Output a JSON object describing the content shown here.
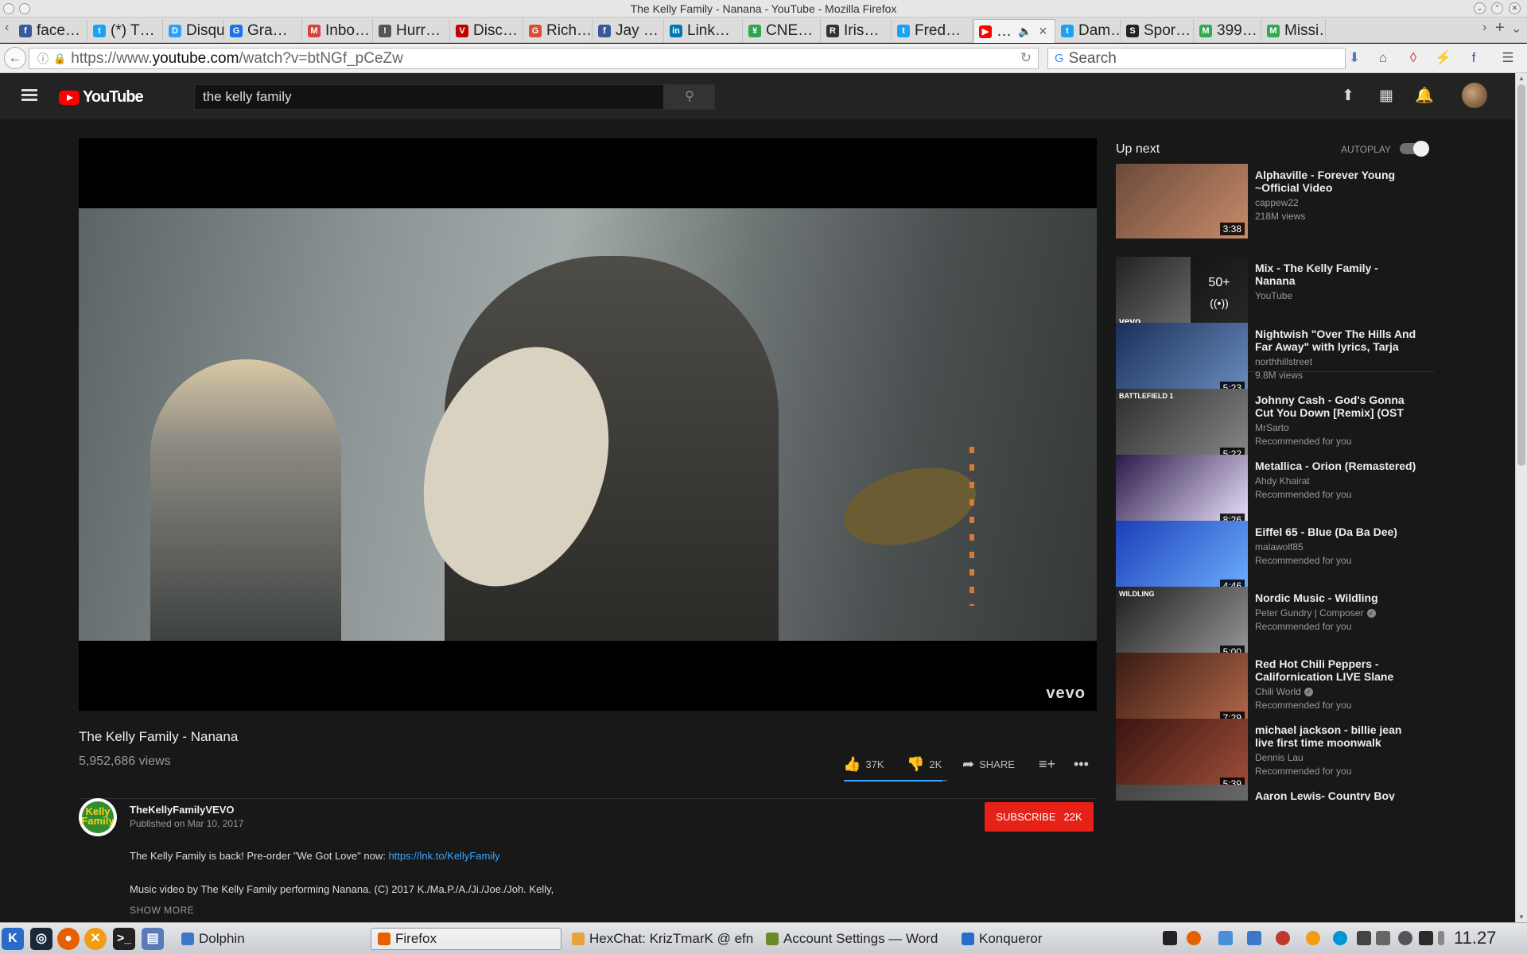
{
  "window": {
    "title": "The Kelly Family - Nanana - YouTube - Mozilla Firefox"
  },
  "tabs": [
    {
      "label": "face…",
      "color": "#3b5998",
      "glyph": "f"
    },
    {
      "label": "(*) T…",
      "color": "#1da1f2",
      "glyph": "t"
    },
    {
      "label": "Disqus",
      "color": "#2e9fff",
      "glyph": "D"
    },
    {
      "label": "Gra…",
      "color": "#1a73e8",
      "glyph": "G"
    },
    {
      "label": "Inbo…",
      "color": "#d44638",
      "glyph": "M"
    },
    {
      "label": "Hurr…",
      "color": "#555555",
      "glyph": "!"
    },
    {
      "label": "Disc…",
      "color": "#c00000",
      "glyph": "V"
    },
    {
      "label": "Rich…",
      "color": "#dd4b39",
      "glyph": "G"
    },
    {
      "label": "Jay …",
      "color": "#3b5998",
      "glyph": "f"
    },
    {
      "label": "Link…",
      "color": "#0077b5",
      "glyph": "in"
    },
    {
      "label": "CNE…",
      "color": "#2aa84a",
      "glyph": "¥"
    },
    {
      "label": "Iris…",
      "color": "#333333",
      "glyph": "R"
    },
    {
      "label": "Fred…",
      "color": "#1da1f2",
      "glyph": "t"
    },
    {
      "label": "…",
      "color": "#ff0000",
      "glyph": "▶",
      "active": true
    },
    {
      "label": "Dam…",
      "color": "#1da1f2",
      "glyph": "t"
    },
    {
      "label": "Spor…",
      "color": "#222222",
      "glyph": "S"
    },
    {
      "label": "399…",
      "color": "#34a853",
      "glyph": "M"
    },
    {
      "label": "Missi…",
      "color": "#34a853",
      "glyph": "M"
    }
  ],
  "nav": {
    "url_prefix": "https://www.",
    "url_domain": "youtube.com",
    "url_path": "/watch?v=btNGf_pCeZw",
    "search_placeholder": "Search"
  },
  "youtube": {
    "logo_text": "YouTube",
    "search_value": "the kelly family",
    "video": {
      "title": "The Kelly Family - Nanana",
      "views": "5,952,686 views",
      "likes": "37K",
      "dislikes": "2K",
      "share_label": "SHARE",
      "like_ratio": 0.95,
      "watermark": "vevo"
    },
    "channel": {
      "name": "TheKellyFamilyVEVO",
      "published": "Published on Mar 10, 2017",
      "avatar_text": "Kelly Family",
      "subscribe_label": "SUBSCRIBE",
      "subscriber_count": "22K"
    },
    "description": {
      "line1": "The Kelly Family is back! Pre-order \"We Got Love\" now: ",
      "link": "https://lnk.to/KellyFamily",
      "line2": "Music video by The Kelly Family performing Nanana. (C) 2017 K./Ma.P./A./Ji./Joe./Joh. Kelly,",
      "show_more": "SHOW MORE"
    },
    "sidebar": {
      "up_next": "Up next",
      "autoplay": "AUTOPLAY",
      "videos": [
        {
          "title": "Alphaville - Forever Young ~Official Video",
          "channel": "cappew22",
          "meta": "218M views",
          "duration": "3:38",
          "thumb": [
            "#6a4a3a",
            "#c88a6a"
          ],
          "progress": 0
        },
        {
          "title": "Mix - The Kelly Family - Nanana",
          "channel": "YouTube",
          "meta": "",
          "duration": "",
          "mix_count": "50+",
          "thumb": [
            "#222222",
            "#888888"
          ],
          "progress": 0,
          "mix": true,
          "thumb_label": "vevo"
        },
        {
          "title": "Nightwish \"Over The Hills And Far Away\" with lyrics, Tarja",
          "channel": "northhillstreet",
          "meta": "9.8M views",
          "duration": "5:23",
          "thumb": [
            "#1b2f5a",
            "#6b8fbf"
          ],
          "progress": 1
        },
        {
          "title": "Johnny Cash - God's Gonna Cut You Down [Remix] (OST",
          "channel": "MrSarto",
          "meta": "Recommended for you",
          "duration": "5:22",
          "thumb": [
            "#2c2c2c",
            "#8a8a8a"
          ],
          "progress": 1,
          "thumb_label": "BATTLEFIELD 1"
        },
        {
          "title": "Metallica - Orion (Remastered)",
          "channel": "Ahdy Khairat",
          "meta": "Recommended for you",
          "duration": "8:26",
          "thumb": [
            "#2a1a4a",
            "#f0e6ff"
          ],
          "progress": 1
        },
        {
          "title": "Eiffel 65 - Blue (Da Ba Dee)",
          "channel": "malawolf85",
          "meta": "Recommended for you",
          "duration": "4:46",
          "thumb": [
            "#1a3fb8",
            "#6fb0ff"
          ],
          "progress": 1
        },
        {
          "title": "Nordic Music - Wildling",
          "channel": "Peter Gundry | Composer",
          "verified": true,
          "meta": "Recommended for you",
          "duration": "5:00",
          "thumb": [
            "#1e1e1e",
            "#9a9a9a"
          ],
          "progress": 0,
          "thumb_label": "WILDLING"
        },
        {
          "title": "Red Hot Chili Peppers - Californication LIVE Slane",
          "channel": "Chili World",
          "verified": true,
          "meta": "Recommended for you",
          "duration": "7:29",
          "thumb": [
            "#3a1a12",
            "#b36a4a"
          ],
          "progress": 0
        },
        {
          "title": "michael jackson - billie jean live first time moonwalk",
          "channel": "Dennis Lau",
          "meta": "Recommended for you",
          "duration": "5:39",
          "thumb": [
            "#3a1410",
            "#a0503a"
          ],
          "progress": 0
        },
        {
          "title": "Aaron Lewis- Country Boy",
          "channel": "",
          "meta": "",
          "duration": "",
          "thumb": [
            "#444444",
            "#777777"
          ],
          "progress": 0
        }
      ]
    }
  },
  "taskbar": {
    "tasks": [
      {
        "label": "Dolphin",
        "color": "#3a78c8"
      },
      {
        "label": "Firefox",
        "color": "#e66000",
        "active": true
      },
      {
        "label": "HexChat: KrizTmarK @ efn",
        "color": "#e6a23c"
      },
      {
        "label": "Account Settings — Word",
        "color": "#6a8a2a"
      },
      {
        "label": "Konqueror",
        "color": "#2a6ac8"
      }
    ],
    "clock": "11.27"
  }
}
